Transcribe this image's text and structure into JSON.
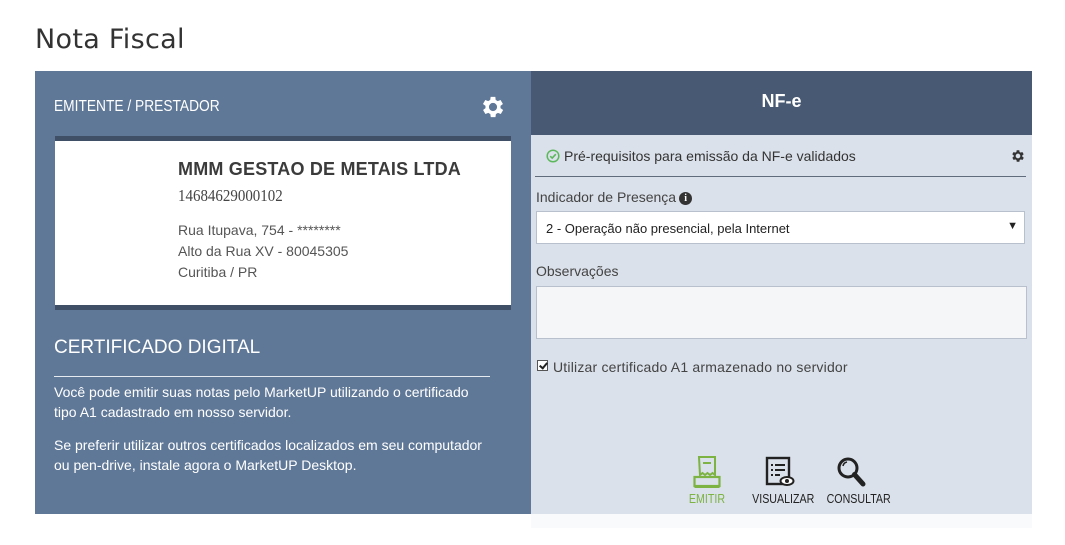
{
  "page": {
    "title": "Nota Fiscal"
  },
  "issuer": {
    "header": "EMITENTE / PRESTADOR",
    "settings_icon": "gear-icon",
    "company_name": "MMM GESTAO DE METAIS LTDA",
    "cnpj": "14684629000102",
    "address_line1": "Rua Itupava, 754 - ********",
    "address_line2": "Alto da Rua XV - 80045305",
    "address_line3": "Curitiba / PR"
  },
  "certificate": {
    "title": "CERTIFICADO DIGITAL",
    "text1": "Você pode emitir suas notas pelo MarketUP utilizando o certificado tipo A1 cadastrado em nosso servidor.",
    "text2": "Se preferir utilizar outros certificados localizados em seu computador ou pen-drive, instale agora o MarketUP Desktop."
  },
  "nfe": {
    "header": "NF-e",
    "prereq_text": "Pré-requisitos para emissão da NF-e validados",
    "presence_label": "Indicador de Presença",
    "presence_value": "2 - Operação não presencial, pela Internet",
    "observations_label": "Observações",
    "observations_value": "",
    "use_a1_label": "Utilizar certificado A1 armazenado no servidor",
    "use_a1_checked": true
  },
  "actions": {
    "emit_label": "EMITIR",
    "view_label": "VISUALIZAR",
    "consult_label": "CONSULTAR"
  },
  "colors": {
    "left_panel": "#607897",
    "right_panel": "#dae1ea",
    "right_header": "#485a73",
    "emit_green": "#7cb342"
  }
}
